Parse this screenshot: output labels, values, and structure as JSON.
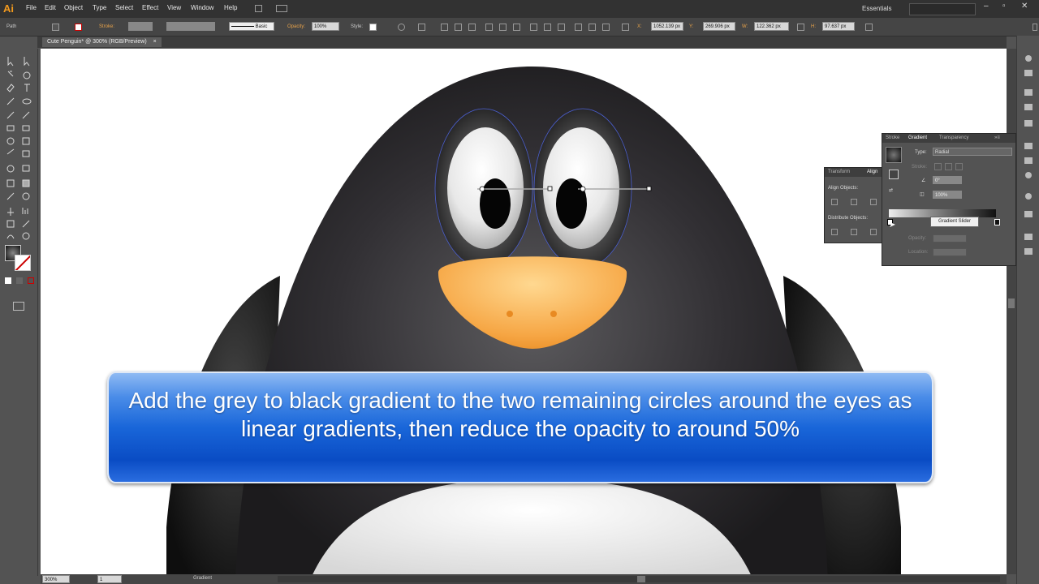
{
  "app": {
    "logo": "Ai",
    "workspace": "Essentials"
  },
  "menu": [
    "File",
    "Edit",
    "Object",
    "Type",
    "Select",
    "Effect",
    "View",
    "Window",
    "Help"
  ],
  "control_bar": {
    "selection_type": "Path",
    "stroke_label": "Stroke:",
    "stroke_profile": "Basic",
    "opacity_label": "Opacity:",
    "opacity_value": "100%",
    "style_label": "Style:",
    "x_label": "X:",
    "x_value": "1052.139 px",
    "y_label": "Y:",
    "y_value": "269.906 px",
    "w_label": "W:",
    "w_value": "122.362 px",
    "h_label": "H:",
    "h_value": "97.637 px"
  },
  "document_tab": {
    "title": "Cute Penguin* @ 300% (RGB/Preview)",
    "close": "×"
  },
  "status_bar": {
    "zoom": "300%",
    "page": "1",
    "current_tool": "Gradient"
  },
  "align_panel": {
    "tabs": [
      "Transform",
      "Align"
    ],
    "align_objects_label": "Align Objects:",
    "distribute_objects_label": "Distribute Objects:"
  },
  "gradient_panel": {
    "tabs": [
      "Stroke",
      "Gradient",
      "Transparency"
    ],
    "type_label": "Type:",
    "type_value": "Radial",
    "stroke_label": "Stroke:",
    "angle_value": "0°",
    "aspect_value": "100%",
    "opacity_label": "Opacity:",
    "location_label": "Location:",
    "tooltip": "Gradient Slider"
  },
  "caption": {
    "text": "Add the grey to black gradient to the two remaining circles around the eyes as linear gradients, then reduce the opacity to around 50%"
  },
  "colors": {
    "accent": "#f39a1e",
    "selection": "#4b5fd0",
    "beak": "#f7a548",
    "caption_blue": "#1966d9"
  }
}
